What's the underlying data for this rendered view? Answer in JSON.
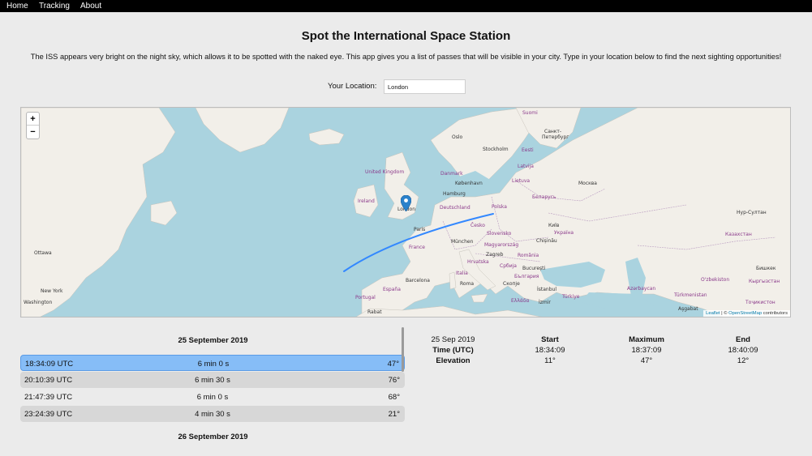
{
  "nav": {
    "items": [
      "Home",
      "Tracking",
      "About"
    ]
  },
  "page": {
    "title": "Spot the International Space Station",
    "intro": "The ISS appears very bright on the night sky, which allows it to be spotted with the naked eye. This app gives you a list of passes that will be visible in your city. Type in your location below to find the next sighting opportunities!"
  },
  "location": {
    "label": "Your Location:",
    "value": "London"
  },
  "map": {
    "zoom_in": "+",
    "zoom_out": "−",
    "attribution": {
      "leaflet": "Leaflet",
      "separator": " | © ",
      "osm": "OpenStreetMap",
      "suffix": " contributors"
    },
    "labels": {
      "suomi": "Suomi",
      "sankt": "Санкт-",
      "peterburg": "Петербург",
      "oslo": "Oslo",
      "stockholm": "Stockholm",
      "eesti": "Eesti",
      "latvija": "Latvija",
      "danmark": "Danmark",
      "kobenhavn": "København",
      "lietuva": "Lietuva",
      "moskva": "Москва",
      "uk": "United Kingdom",
      "ireland": "Ireland",
      "hamburg": "Hamburg",
      "belarus": "Беларусь",
      "deutschland": "Deutschland",
      "polska": "Polska",
      "london": "London",
      "kyiv": "Київ",
      "nursultan": "Нур-Султан",
      "paris": "Paris",
      "cesko": "Česko",
      "ukraina": "Україна",
      "slovensko": "Slovensko",
      "kazakhstan": "Казахстан",
      "france": "France",
      "munchen": "München",
      "magyarorszag": "Magyarország",
      "chisinau": "Chișinău",
      "ottawa": "Ottawa",
      "zagreb": "Zagreb",
      "romania": "România",
      "hrvatska": "Hrvatska",
      "srbija": "Србија",
      "bucuresti": "București",
      "bishkek": "Бишкек",
      "uzbekistan": "O'zbekiston",
      "kyrgyzstan": "Кыргызстан",
      "bulgaria": "България",
      "skopje": "Скопје",
      "barcelona": "Barcelona",
      "roma": "Roma",
      "italia": "Italia",
      "azerbaycan": "Azərbaycan",
      "newyork": "New York",
      "espana": "España",
      "istanbul": "İstanbul",
      "turkmenistan": "Türkmenistan",
      "tojikiston": "Тоҷикистон",
      "washington": "Washington",
      "portugal": "Portugal",
      "ellada": "Ελλάδα",
      "izmir": "İzmir",
      "turkiye": "Türkiye",
      "ashgabat": "Aşgabat",
      "rabat": "Rabat"
    }
  },
  "passes": {
    "day1": "25 September 2019",
    "day2": "26 September 2019",
    "rows": [
      {
        "time": "18:34:09 UTC",
        "duration": "6 min 0 s",
        "elevation": "47°"
      },
      {
        "time": "20:10:39 UTC",
        "duration": "6 min 30 s",
        "elevation": "76°"
      },
      {
        "time": "21:47:39 UTC",
        "duration": "6 min 0 s",
        "elevation": "68°"
      },
      {
        "time": "23:24:39 UTC",
        "duration": "4 min 30 s",
        "elevation": "21°"
      }
    ]
  },
  "detail": {
    "date": "25 Sep 2019",
    "row_time": "Time (UTC)",
    "row_elev": "Elevation",
    "start": {
      "label": "Start",
      "time": "18:34:09",
      "elev": "11°"
    },
    "max": {
      "label": "Maximum",
      "time": "18:37:09",
      "elev": "47°"
    },
    "end": {
      "label": "End",
      "time": "18:40:09",
      "elev": "12°"
    }
  },
  "colors": {
    "track": "#3388ff",
    "selected_row": "#86bdf7",
    "pin": "#2a81cb",
    "water": "#aad3df",
    "land": "#f2efe9"
  }
}
